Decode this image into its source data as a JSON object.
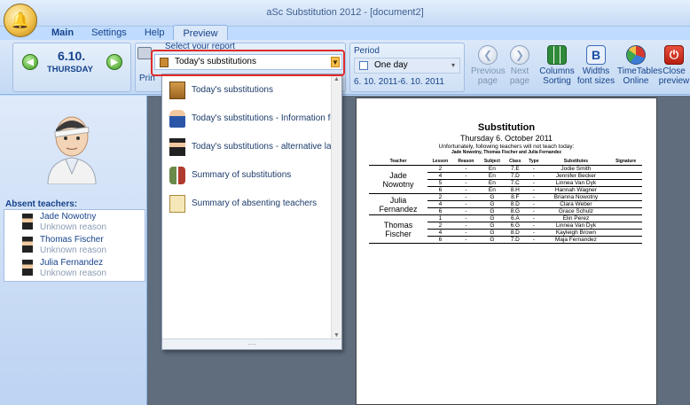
{
  "window": {
    "title": "aSc Substitution 2012 - [document2]"
  },
  "tabs": [
    {
      "label": "Main"
    },
    {
      "label": "Settings"
    },
    {
      "label": "Help"
    },
    {
      "label": "Preview"
    }
  ],
  "date_nav": {
    "date": "6.10.",
    "day": "THURSDAY"
  },
  "report": {
    "group_label": "Select your report",
    "selected": "Today's substitutions",
    "print_label": "Prin",
    "items": [
      {
        "label": "Today's substitutions",
        "icon": "document-icon"
      },
      {
        "label": "Today's substitutions - Information for st",
        "icon": "teacher-icon"
      },
      {
        "label": "Today's substitutions - alternative layout",
        "icon": "graduate-icon"
      },
      {
        "label": "Summary of substitutions",
        "icon": "people-icon"
      },
      {
        "label": "Summary of absenting teachers",
        "icon": "chart-document-icon"
      }
    ]
  },
  "period": {
    "label": "Period",
    "selected": "One day",
    "range": "6. 10. 2011-6. 10. 2011"
  },
  "toolbar": {
    "previous_page": "Previous\npage",
    "next_page": "Next\npage",
    "columns_sorting": "Columns\nSorting",
    "widths_font_sizes": "Widths\nfont sizes",
    "timetables_online": "TimeTables\nOnline",
    "close_preview": "Close\npreview"
  },
  "absent": {
    "label": "Absent teachers:",
    "teachers": [
      {
        "name": "Jade Nowotny",
        "reason": "Unknown reason"
      },
      {
        "name": "Thomas Fischer",
        "reason": "Unknown reason"
      },
      {
        "name": "Julia Fernandez",
        "reason": "Unknown reason"
      }
    ]
  },
  "document": {
    "title": "Substitution",
    "date": "Thursday 6. October 2011",
    "note": "Unfortunately, following teachers will not teach today:",
    "note_names": "Jade Nowotny, Thomas Fischer and Julia Fernandez",
    "headers": [
      "Teacher",
      "Lesson",
      "Reason",
      "Subject",
      "Class",
      "Type",
      "Substitutes",
      "Signature"
    ],
    "groups": [
      {
        "teacher": "Jade Nowotny",
        "rows": [
          [
            "2",
            "-",
            "En",
            "7.E",
            "-",
            "Jodie Smith",
            ""
          ],
          [
            "4",
            "-",
            "En",
            "7.D",
            "-",
            "Jennifer Becker",
            ""
          ],
          [
            "5",
            "-",
            "En",
            "7.C",
            "-",
            "Linnea Van Dyk",
            ""
          ],
          [
            "6",
            "-",
            "En",
            "8.H",
            "-",
            "Hannah Wagner",
            ""
          ]
        ]
      },
      {
        "teacher": "Julia Fernandez",
        "rows": [
          [
            "2",
            "-",
            "G",
            "8.F",
            "-",
            "Brianna Nowotny",
            ""
          ],
          [
            "4",
            "-",
            "G",
            "8.D",
            "-",
            "Clara Weber",
            ""
          ],
          [
            "6",
            "-",
            "G",
            "8.G",
            "-",
            "Grace Schulz",
            ""
          ]
        ]
      },
      {
        "teacher": "Thomas Fischer",
        "rows": [
          [
            "1",
            "-",
            "G",
            "6.A",
            "-",
            "Elin Perez",
            ""
          ],
          [
            "2",
            "-",
            "G",
            "6.G",
            "-",
            "Linnea Van Dyk",
            ""
          ],
          [
            "4",
            "-",
            "G",
            "8.D",
            "-",
            "Kayleigh Brown",
            ""
          ],
          [
            "6",
            "-",
            "G",
            "7.D",
            "-",
            "Maja Fernandez",
            ""
          ]
        ]
      }
    ]
  }
}
